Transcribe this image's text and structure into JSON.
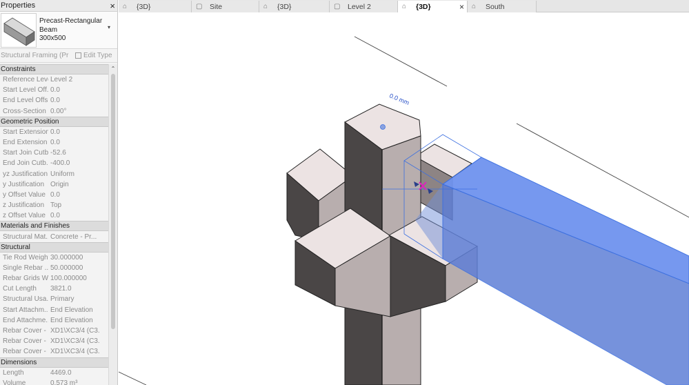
{
  "properties": {
    "title": "Properties",
    "close_glyph": "×",
    "type_line1": "Precast-Rectangular",
    "type_line2": "Beam",
    "type_line3": "300x500",
    "dropdown_glyph": "▾",
    "filter_text": "Structural Framing (Pr",
    "edit_type_label": "Edit Type",
    "collapse_glyph": "»",
    "groups": [
      {
        "name": "Constraints",
        "rows": [
          {
            "name": "Reference Level",
            "value": "Level 2"
          },
          {
            "name": "Start Level Off...",
            "value": "0.0"
          },
          {
            "name": "End Level Offs...",
            "value": "0.0"
          },
          {
            "name": "Cross-Section ...",
            "value": "0.00°"
          }
        ]
      },
      {
        "name": "Geometric Position",
        "rows": [
          {
            "name": "Start Extension",
            "value": "0.0"
          },
          {
            "name": "End Extension",
            "value": "0.0"
          },
          {
            "name": "Start Join Cutb...",
            "value": "-52.6"
          },
          {
            "name": "End Join Cutb...",
            "value": "-400.0"
          },
          {
            "name": "yz Justification",
            "value": "Uniform"
          },
          {
            "name": "y Justification",
            "value": "Origin"
          },
          {
            "name": "y Offset Value",
            "value": "0.0"
          },
          {
            "name": "z Justification",
            "value": "Top"
          },
          {
            "name": "z Offset Value",
            "value": "0.0"
          }
        ]
      },
      {
        "name": "Materials and Finishes",
        "rows": [
          {
            "name": "Structural Mat...",
            "value": "Concrete - Pr..."
          }
        ]
      },
      {
        "name": "Structural",
        "rows": [
          {
            "name": "Tie Rod Weight",
            "value": "30.000000"
          },
          {
            "name": "Single Rebar ...",
            "value": "50.000000"
          },
          {
            "name": "Rebar Grids W...",
            "value": "100.000000"
          },
          {
            "name": "Cut Length",
            "value": "3821.0"
          },
          {
            "name": "Structural Usa...",
            "value": "Primary"
          },
          {
            "name": "Start Attachm...",
            "value": "End Elevation"
          },
          {
            "name": "End Attachme...",
            "value": "End Elevation"
          },
          {
            "name": "Rebar Cover - ...",
            "value": "XD1\\XC3/4 (C3..."
          },
          {
            "name": "Rebar Cover - ...",
            "value": "XD1\\XC3/4 (C3..."
          },
          {
            "name": "Rebar Cover - ...",
            "value": "XD1\\XC3/4 (C3..."
          }
        ]
      },
      {
        "name": "Dimensions",
        "rows": [
          {
            "name": "Length",
            "value": "4469.0"
          },
          {
            "name": "Volume",
            "value": "0.573 m³"
          }
        ]
      }
    ]
  },
  "tabs": [
    {
      "label": "{3D}",
      "icon": "home-icon",
      "active": false
    },
    {
      "label": "Site",
      "icon": "plan-icon",
      "active": false
    },
    {
      "label": "{3D}",
      "icon": "home-icon",
      "active": false
    },
    {
      "label": "Level 2",
      "icon": "plan-icon",
      "active": false
    },
    {
      "label": "{3D}",
      "icon": "home-icon",
      "active": true
    },
    {
      "label": "South",
      "icon": "home-icon",
      "active": false
    }
  ],
  "tab_close_glyph": "×",
  "viewport": {
    "dimension_text": "0.0 mm",
    "colors": {
      "concrete_top": "#ece3e3",
      "concrete_light": "#b8aeae",
      "concrete_dark": "#4a4646",
      "beam_selected": "#6f93ef",
      "selection_lines": "#3b6fe0",
      "snap_marker": "#e020c0"
    }
  }
}
